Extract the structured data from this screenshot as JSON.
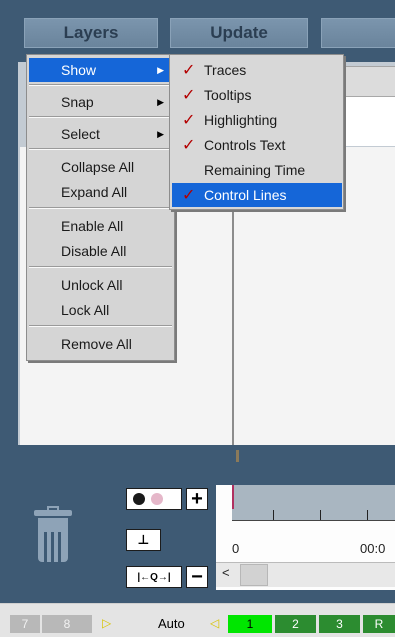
{
  "header": {
    "layers_label": "Layers",
    "update_label": "Update"
  },
  "context_menu": {
    "items": [
      {
        "label": "Show",
        "has_submenu": true,
        "highlighted": true
      },
      {
        "label": "Snap",
        "has_submenu": true
      },
      {
        "label": "Select",
        "has_submenu": true
      },
      {
        "label": "Collapse All"
      },
      {
        "label": "Expand All"
      },
      {
        "label": "Enable All"
      },
      {
        "label": "Disable All"
      },
      {
        "label": "Unlock All"
      },
      {
        "label": "Lock All"
      },
      {
        "label": "Remove All"
      }
    ]
  },
  "show_submenu": {
    "items": [
      {
        "label": "Traces",
        "checked": true
      },
      {
        "label": "Tooltips",
        "checked": true
      },
      {
        "label": "Highlighting",
        "checked": true
      },
      {
        "label": "Controls Text",
        "checked": true
      },
      {
        "label": "Remaining Time",
        "checked": false
      },
      {
        "label": "Control Lines",
        "checked": true,
        "highlighted": true
      }
    ],
    "check_glyph": "✓"
  },
  "timeline": {
    "start_label": "0",
    "time_label": "00:0",
    "scroll_left": "<"
  },
  "controls": {
    "plus": "+",
    "minus": "−",
    "split": "⊥",
    "zoom": "|←Q→|"
  },
  "statusbar": {
    "auto_label": "Auto",
    "gray_pages": [
      "7",
      "8"
    ],
    "green_pages": [
      "1",
      "2",
      "3",
      "R"
    ],
    "play_glyph": "▷",
    "left_glyph": "◁"
  },
  "colors": {
    "background": "#3e5a74",
    "menu_highlight": "#1566d8",
    "check": "#b30000",
    "active_page": "#00e600",
    "page_green": "#2c8c30"
  }
}
